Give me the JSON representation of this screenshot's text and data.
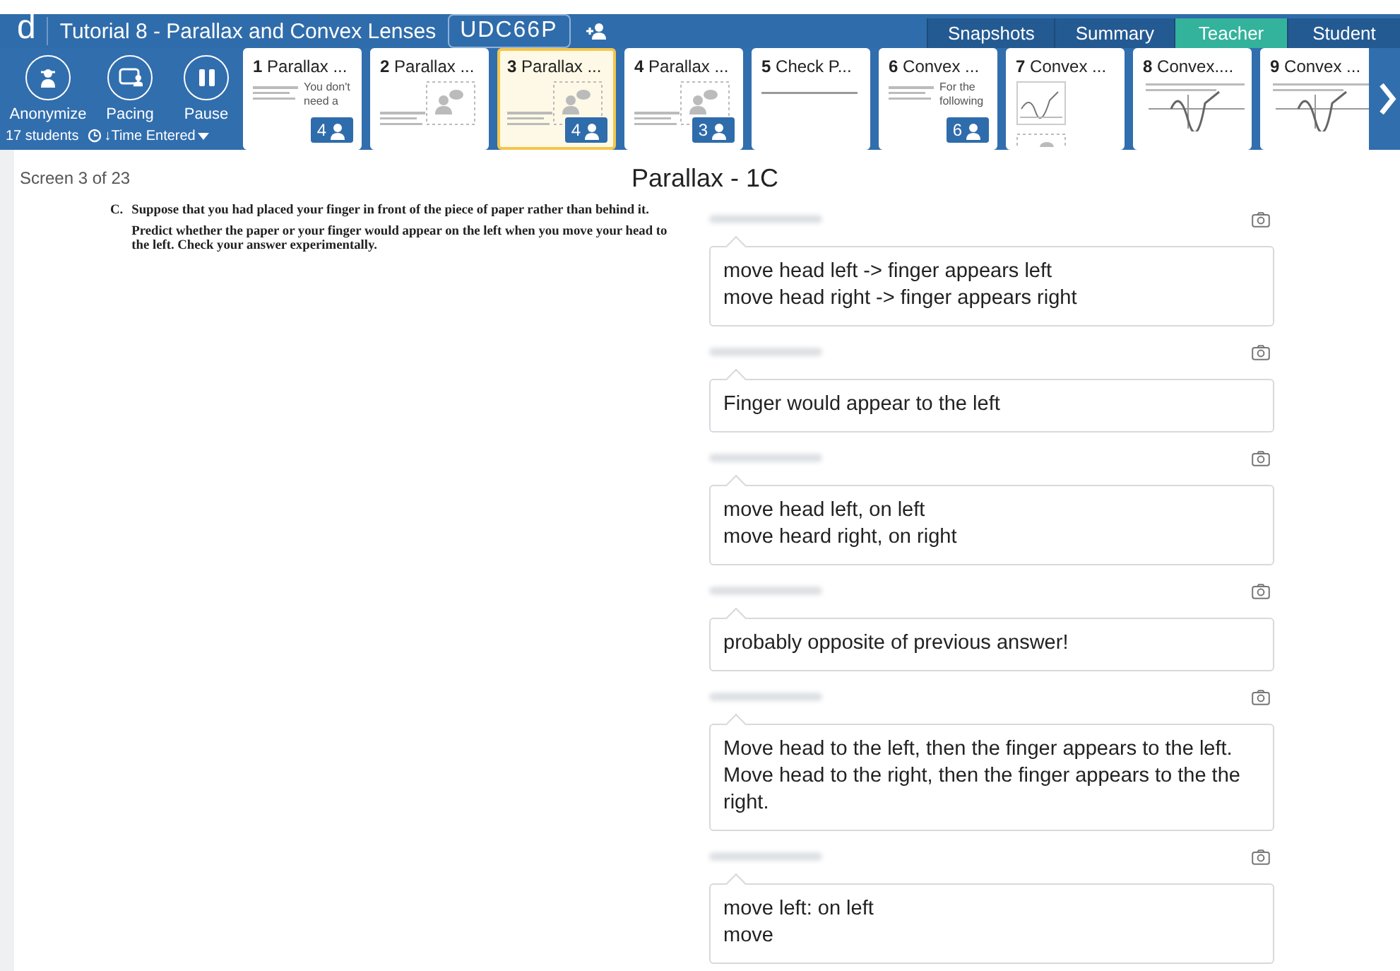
{
  "header": {
    "logo": "d",
    "title": "Tutorial 8 - Parallax and Convex Lenses",
    "class_code": "UDC66P"
  },
  "view_tabs": [
    {
      "label": "Snapshots",
      "selected": false
    },
    {
      "label": "Summary",
      "selected": false
    },
    {
      "label": "Teacher",
      "selected": true
    },
    {
      "label": "Student",
      "selected": false
    }
  ],
  "tools": [
    {
      "kind": "anonymize",
      "label": "Anonymize"
    },
    {
      "kind": "pacing",
      "label": "Pacing"
    },
    {
      "kind": "pause",
      "label": "Pause"
    }
  ],
  "student_count": "17 students",
  "sort": "↓Time Entered",
  "slides": [
    {
      "number": "1",
      "title": "Parallax ...",
      "selected": false,
      "kind": "response",
      "snippet": "You don't need a",
      "count": "4"
    },
    {
      "number": "2",
      "title": "Parallax ...",
      "selected": false,
      "kind": "response"
    },
    {
      "number": "3",
      "title": "Parallax ...",
      "selected": true,
      "kind": "response",
      "count": "4"
    },
    {
      "number": "4",
      "title": "Parallax ...",
      "selected": false,
      "kind": "response",
      "count": "3"
    },
    {
      "number": "5",
      "title": "Check P...",
      "selected": false,
      "kind": "note"
    },
    {
      "number": "6",
      "title": "Convex ...",
      "selected": false,
      "kind": "response",
      "snippet": "For the following",
      "count": "6"
    },
    {
      "number": "7",
      "title": "Convex ...",
      "selected": false,
      "kind": "sketch"
    },
    {
      "number": "8",
      "title": "Convex....",
      "selected": false,
      "kind": "graph"
    },
    {
      "number": "9",
      "title": "Convex ...",
      "selected": false,
      "kind": "graph"
    }
  ],
  "screen_label": "Screen 3 of 23",
  "screen_title": "Parallax - 1C",
  "question": {
    "marker": "C.",
    "paragraphs": [
      "Suppose that you had placed your finger in front of the piece of paper rather than behind it.",
      "Predict whether the paper or your finger would appear on the left when you move your head to the left.  Check your answer experimentally."
    ]
  },
  "responses": [
    {
      "text": "move head left -> finger appears left\nmove head right -> finger appears right"
    },
    {
      "text": "Finger would appear to the left"
    },
    {
      "text": "move head left, on left\nmove heard right, on right"
    },
    {
      "text": "probably opposite of previous answer!"
    },
    {
      "text": "Move head to the left, then the finger appears to the left. Move head to the right, then the finger appears to the the right."
    },
    {
      "text": "move left: on left\nmove"
    }
  ]
}
